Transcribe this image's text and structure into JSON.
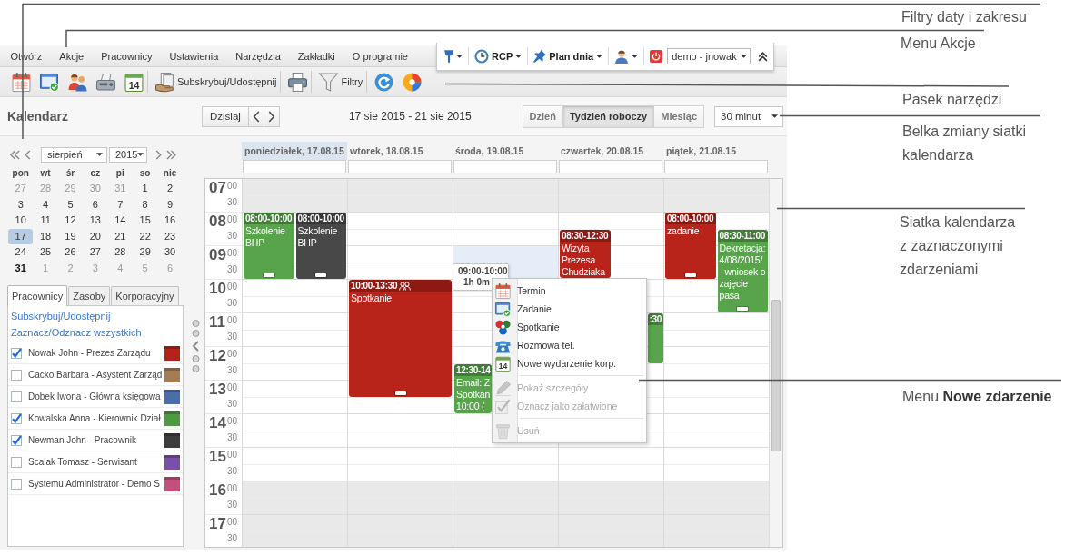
{
  "annotations": [
    {
      "text": "Filtry daty i zakresu"
    },
    {
      "text": "Menu Akcje"
    },
    {
      "text": "Pasek narzędzi"
    },
    {
      "text": "Belka zmiany siatki kalendarza"
    },
    {
      "text": "Siatka kalendarza z zaznaczonymi zdarzeniami"
    },
    {
      "text": "Menu **Nowe zdarzenie**"
    }
  ],
  "menu_bar": [
    "Otwórz",
    "Akcje",
    "Pracownicy",
    "Ustawienia",
    "Narzędzia",
    "Zakładki",
    "O programie"
  ],
  "quick_bar": {
    "items": [
      {
        "kind": "marker",
        "dropdown": true
      },
      {
        "kind": "clock",
        "label": "RCP",
        "dropdown": true
      },
      {
        "kind": "pin",
        "label": "Plan dnia",
        "dropdown": true
      },
      {
        "kind": "person",
        "dropdown": true
      },
      {
        "kind": "power",
        "dropdown": false
      }
    ],
    "user": "demo - jnowak"
  },
  "toolbar": [
    {
      "kind": "calendar"
    },
    {
      "kind": "task"
    },
    {
      "kind": "people"
    },
    {
      "kind": "fax"
    },
    {
      "kind": "calendar-day",
      "number": "14"
    },
    {
      "kind": "separator"
    },
    {
      "kind": "share",
      "label": "Subskrybuj/Udostępnij"
    },
    {
      "kind": "separator"
    },
    {
      "kind": "printer"
    },
    {
      "kind": "separator"
    },
    {
      "kind": "filter",
      "label": "Filtry"
    },
    {
      "kind": "separator"
    },
    {
      "kind": "refresh"
    },
    {
      "kind": "color-wheel"
    }
  ],
  "header": {
    "title": "Kalendarz",
    "today": "Dzisiaj",
    "range": "17 sie 2015 - 21 sie 2015",
    "views": [
      {
        "label": "Dzień",
        "selected": false
      },
      {
        "label": "Tydzień roboczy",
        "selected": true
      },
      {
        "label": "Miesiąc",
        "selected": false
      }
    ],
    "interval": "30 minut"
  },
  "mini_calendar": {
    "month": "sierpień",
    "year": "2015",
    "weekdays": [
      "pon",
      "wt",
      "śr",
      "cz",
      "pi",
      "so",
      "nie"
    ],
    "weeks": [
      [
        {
          "day": "27",
          "other_month": true,
          "selected": false,
          "today": false
        },
        {
          "day": "28",
          "other_month": true,
          "selected": false,
          "today": false
        },
        {
          "day": "29",
          "other_month": true,
          "selected": false,
          "today": false
        },
        {
          "day": "30",
          "other_month": true,
          "selected": false,
          "today": false
        },
        {
          "day": "31",
          "other_month": true,
          "selected": false,
          "today": false
        },
        {
          "day": "1",
          "other_month": false,
          "selected": false,
          "today": false
        },
        {
          "day": "2",
          "other_month": false,
          "selected": false,
          "today": false
        }
      ],
      [
        {
          "day": "3",
          "other_month": false,
          "selected": false,
          "today": false
        },
        {
          "day": "4",
          "other_month": false,
          "selected": false,
          "today": false
        },
        {
          "day": "5",
          "other_month": false,
          "selected": false,
          "today": false
        },
        {
          "day": "6",
          "other_month": false,
          "selected": false,
          "today": false
        },
        {
          "day": "7",
          "other_month": false,
          "selected": false,
          "today": false
        },
        {
          "day": "8",
          "other_month": false,
          "selected": false,
          "today": false
        },
        {
          "day": "9",
          "other_month": false,
          "selected": false,
          "today": false
        }
      ],
      [
        {
          "day": "10",
          "other_month": false,
          "selected": false,
          "today": false
        },
        {
          "day": "11",
          "other_month": false,
          "selected": false,
          "today": false
        },
        {
          "day": "12",
          "other_month": false,
          "selected": false,
          "today": false
        },
        {
          "day": "13",
          "other_month": false,
          "selected": false,
          "today": false
        },
        {
          "day": "14",
          "other_month": false,
          "selected": false,
          "today": false
        },
        {
          "day": "15",
          "other_month": false,
          "selected": false,
          "today": false
        },
        {
          "day": "16",
          "other_month": false,
          "selected": false,
          "today": false
        }
      ],
      [
        {
          "day": "17",
          "other_month": false,
          "selected": true,
          "today": false
        },
        {
          "day": "18",
          "other_month": false,
          "selected": false,
          "today": false
        },
        {
          "day": "19",
          "other_month": false,
          "selected": false,
          "today": false
        },
        {
          "day": "20",
          "other_month": false,
          "selected": false,
          "today": false
        },
        {
          "day": "21",
          "other_month": false,
          "selected": false,
          "today": false
        },
        {
          "day": "22",
          "other_month": false,
          "selected": false,
          "today": false
        },
        {
          "day": "23",
          "other_month": false,
          "selected": false,
          "today": false
        }
      ],
      [
        {
          "day": "24",
          "other_month": false,
          "selected": false,
          "today": false
        },
        {
          "day": "25",
          "other_month": false,
          "selected": false,
          "today": false
        },
        {
          "day": "26",
          "other_month": false,
          "selected": false,
          "today": false
        },
        {
          "day": "27",
          "other_month": false,
          "selected": false,
          "today": false
        },
        {
          "day": "28",
          "other_month": false,
          "selected": false,
          "today": false
        },
        {
          "day": "29",
          "other_month": false,
          "selected": false,
          "today": false
        },
        {
          "day": "30",
          "other_month": false,
          "selected": false,
          "today": false
        }
      ],
      [
        {
          "day": "31",
          "other_month": false,
          "selected": false,
          "today": true
        },
        {
          "day": "1",
          "other_month": true,
          "selected": false,
          "today": false
        },
        {
          "day": "2",
          "other_month": true,
          "selected": false,
          "today": false
        },
        {
          "day": "3",
          "other_month": true,
          "selected": false,
          "today": false
        },
        {
          "day": "4",
          "other_month": true,
          "selected": false,
          "today": false
        },
        {
          "day": "5",
          "other_month": true,
          "selected": false,
          "today": false
        },
        {
          "day": "6",
          "other_month": true,
          "selected": false,
          "today": false
        }
      ]
    ]
  },
  "sidebar": {
    "tabs": [
      {
        "label": "Pracownicy",
        "selected": true
      },
      {
        "label": "Zasoby",
        "selected": false
      },
      {
        "label": "Korporacyjny",
        "selected": false
      }
    ],
    "links": [
      "Subskrybuj/Udostępnij",
      "Zaznacz/Odznacz wszystkich"
    ],
    "people": [
      {
        "name": "Nowak John - Prezes Zarządu",
        "checked": true,
        "color": "#b52318"
      },
      {
        "name": "Cacko Barbara - Asystent Zarząd",
        "checked": false,
        "color": "#a67c52"
      },
      {
        "name": "Dobek Iwona - Główna księgowa",
        "checked": false,
        "color": "#4a6ea9"
      },
      {
        "name": "Kowalska Anna - Kierownik Dział",
        "checked": true,
        "color": "#4e9a41"
      },
      {
        "name": "Newman John - Pracownik",
        "checked": true,
        "color": "#3d3d3d"
      },
      {
        "name": "Scalak Tomasz - Serwisant",
        "checked": false,
        "color": "#7a4fa8"
      },
      {
        "name": "Systemu Administrator - Demo S",
        "checked": false,
        "color": "#c44f7f"
      }
    ]
  },
  "calendar": {
    "days": [
      {
        "label": "poniedziałek, 17.08.15",
        "selected": true
      },
      {
        "label": "wtorek, 18.08.15",
        "selected": false
      },
      {
        "label": "środa, 19.08.15",
        "selected": false
      },
      {
        "label": "czwartek, 20.08.15",
        "selected": false
      },
      {
        "label": "piątek, 21.08.15",
        "selected": false
      }
    ],
    "hours": [
      {
        "hour": "07",
        "minutes": [
          "00",
          "30"
        ],
        "working": false,
        "cells": [
          {},
          {},
          {},
          {},
          {}
        ]
      },
      {
        "hour": "08",
        "minutes": [
          "00",
          "30"
        ],
        "working": true,
        "cells": [
          {
            "events": [
              {
                "kind": "appointment",
                "time": "08:00-10:00",
                "title": "Szkolenie BHP",
                "color": "#58a44b",
                "resize_grip": true
              },
              {
                "kind": "appointment",
                "time": "08:00-10:00",
                "title": "Szkolenie BHP",
                "color": "#484848",
                "resize_grip": true
              }
            ]
          },
          {},
          {},
          {
            "events": [
              {
                "kind": "appointment",
                "time": "08:30-12:30",
                "title": "Wizyta Prezesa Chudziaka",
                "color": "#b8231a",
                "resize_grip": false
              }
            ]
          },
          {
            "events": [
              {
                "kind": "appointment",
                "time": "08:00-10:00",
                "title": "zadanie",
                "color": "#b8231a",
                "resize_grip": true
              },
              {
                "kind": "appointment",
                "time": "08:30-11:00",
                "title": "Dekretacja: 4/08/2015/ - wniosek o zajęcie pasa",
                "color": "#58a44b",
                "resize_grip": true
              }
            ]
          }
        ]
      },
      {
        "hour": "09",
        "minutes": [
          "00",
          "30"
        ],
        "working": true,
        "cells": [
          {},
          {},
          {
            "selection": {
              "time": "09:00-10:00",
              "duration": "1h 0m"
            }
          },
          {},
          {}
        ]
      },
      {
        "hour": "10",
        "minutes": [
          "00",
          "30"
        ],
        "working": true,
        "cells": [
          {},
          {
            "events": [
              {
                "kind": "meeting",
                "time": "10:00-13:30",
                "title": "Spotkanie",
                "color": "#b8231a",
                "resize_grip": true
              }
            ]
          },
          {},
          {},
          {}
        ]
      },
      {
        "hour": "11",
        "minutes": [
          "00",
          "30"
        ],
        "working": true,
        "cells": [
          {},
          {},
          {},
          {
            "events": [
              {
                "kind": "appointment",
                "time": ":30",
                "color": "#58a44b",
                "resize_grip": false
              }
            ]
          },
          {}
        ]
      },
      {
        "hour": "12",
        "minutes": [
          "00",
          "30"
        ],
        "working": true,
        "cells": [
          {},
          {},
          {
            "events": [
              {
                "kind": "appointment",
                "time": "12:30-14",
                "title": "Email: Z\nSpotkan\n10:00 (",
                "color": "#58a44b",
                "resize_grip": false
              }
            ]
          },
          {},
          {}
        ]
      },
      {
        "hour": "13",
        "minutes": [
          "00",
          "30"
        ],
        "working": true,
        "cells": [
          {},
          {},
          {},
          {},
          {}
        ]
      },
      {
        "hour": "14",
        "minutes": [
          "00",
          "30"
        ],
        "working": true,
        "cells": [
          {},
          {},
          {},
          {},
          {}
        ]
      },
      {
        "hour": "15",
        "minutes": [
          "00",
          "30"
        ],
        "working": true,
        "cells": [
          {},
          {},
          {},
          {},
          {}
        ]
      },
      {
        "hour": "16",
        "minutes": [
          "00",
          "30"
        ],
        "working": false,
        "cells": [
          {},
          {},
          {},
          {},
          {}
        ]
      },
      {
        "hour": "17",
        "minutes": [
          "00",
          "30"
        ],
        "working": false,
        "cells": [
          {},
          {},
          {},
          {},
          {}
        ]
      }
    ]
  },
  "context_menu": {
    "groups": [
      [
        {
          "kind": "appointment",
          "label": "Termin",
          "disabled": false
        },
        {
          "kind": "task",
          "label": "Zadanie",
          "disabled": false
        },
        {
          "kind": "meeting",
          "label": "Spotkanie",
          "disabled": false
        },
        {
          "kind": "phone",
          "label": "Rozmowa tel.",
          "disabled": false
        },
        {
          "kind": "corporate",
          "label": "Nowe wydarzenie korp.",
          "number": "14",
          "disabled": false
        }
      ],
      [
        {
          "kind": "details",
          "label": "Pokaż szczegóły",
          "disabled": true
        },
        {
          "kind": "done",
          "label": "Oznacz jako załatwione",
          "disabled": true
        }
      ],
      [
        {
          "kind": "delete",
          "label": "Usuń",
          "disabled": true
        }
      ]
    ]
  }
}
